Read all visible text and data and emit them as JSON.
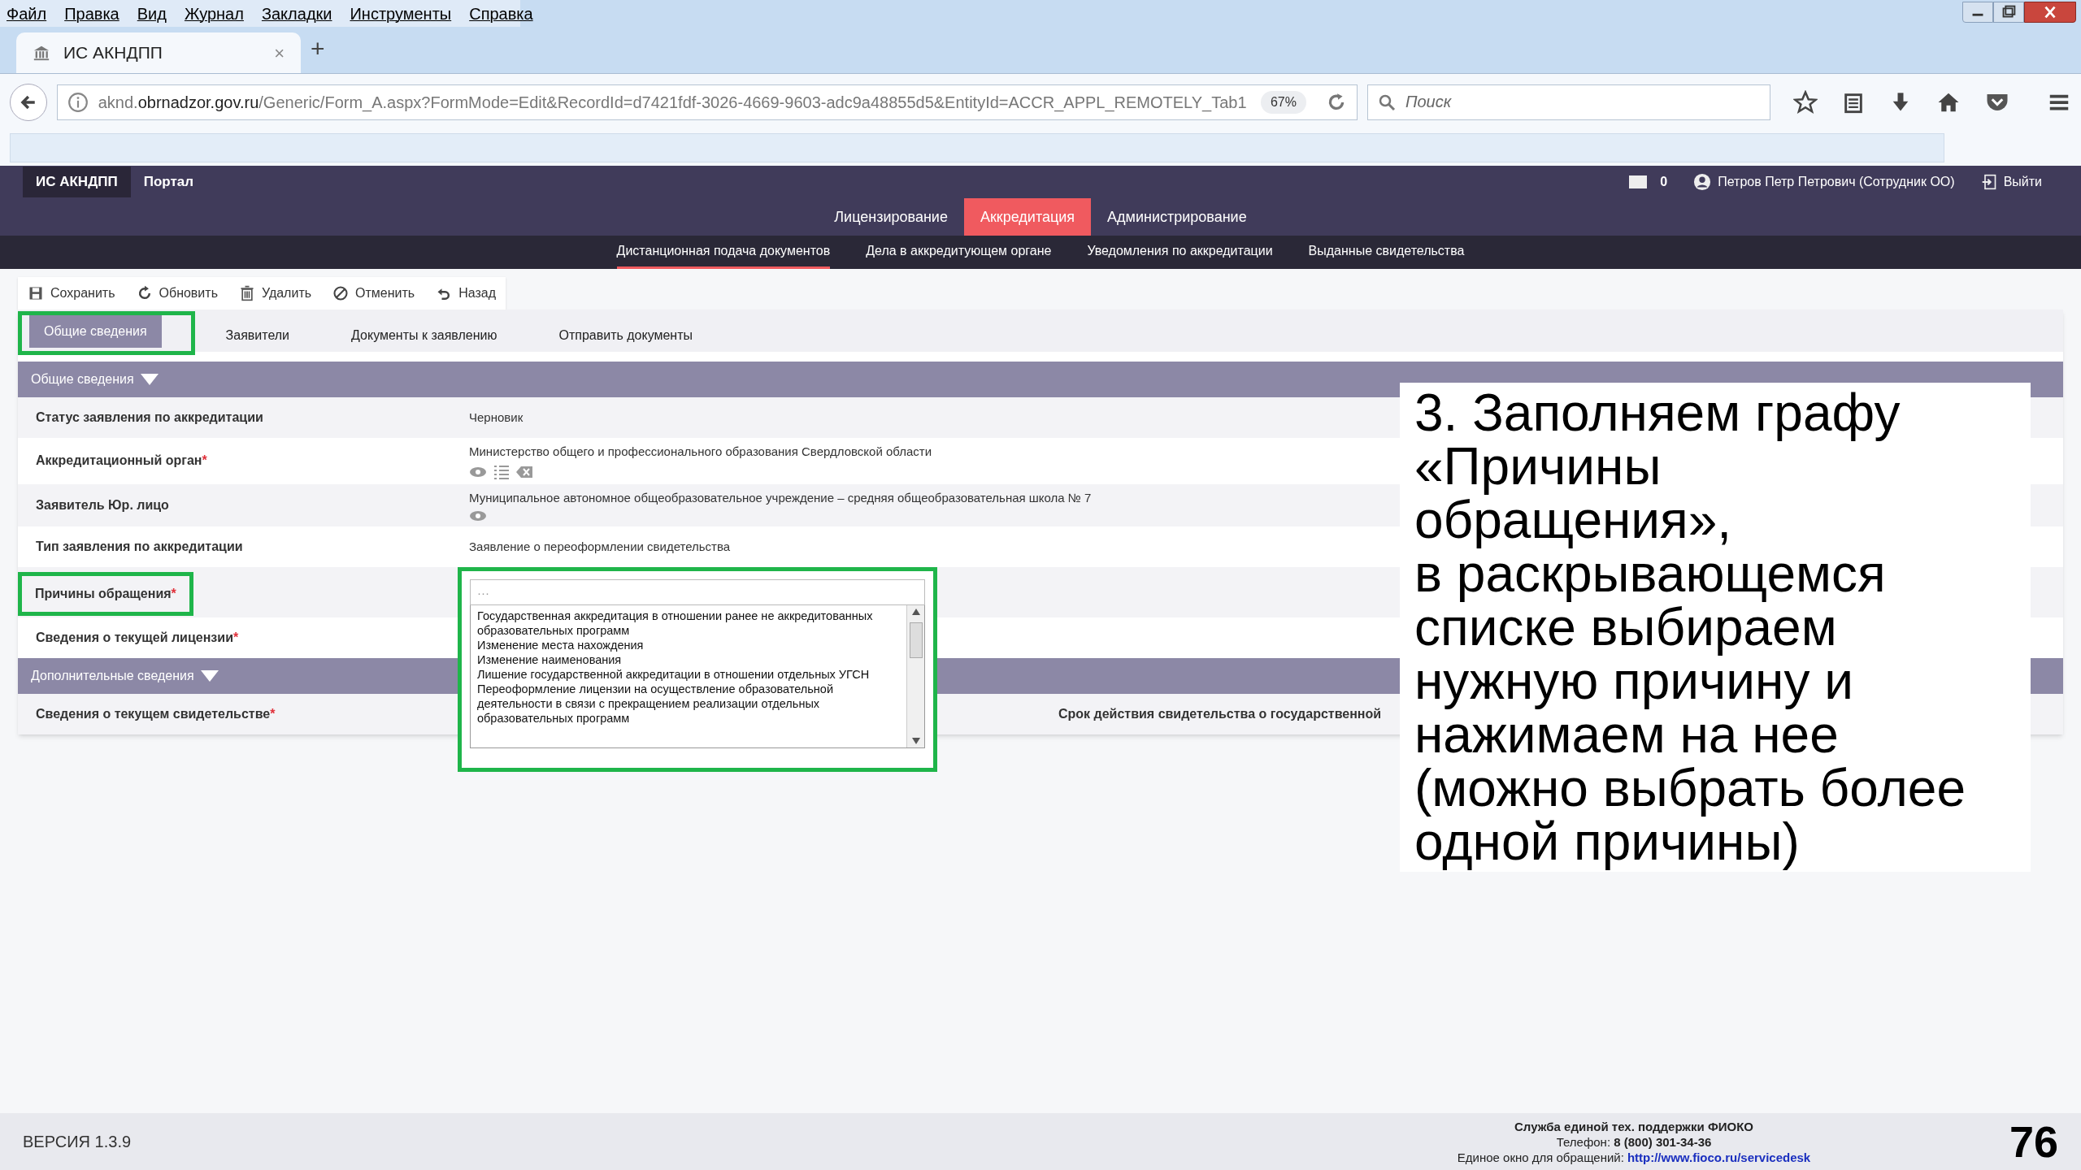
{
  "menu_bar": [
    "Файл",
    "Правка",
    "Вид",
    "Журнал",
    "Закладки",
    "Инструменты",
    "Справка"
  ],
  "browser_tab": {
    "title": "ИС АКНДПП",
    "close": "×"
  },
  "new_tab": "+",
  "address_bar": {
    "prefix": "aknd.",
    "domain": "obrnadzor.gov.ru",
    "path": "/Generic/Form_A.aspx?FormMode=Edit&RecordId=d7421fdf-3026-4669-9603-adc9a48855d5&EntityId=ACCR_APPL_REMOTELY_Tab1",
    "zoom": "67%"
  },
  "search": {
    "placeholder": "Поиск"
  },
  "app": {
    "brand": "ИС АКНДПП",
    "portal": "Портал",
    "messages_count": "0",
    "user": "Петров Петр Петрович (Сотрудник ОО)",
    "logout": "Выйти",
    "nav": [
      {
        "label": "Лицензирование",
        "selected": false
      },
      {
        "label": "Аккредитация",
        "selected": true
      },
      {
        "label": "Администрирование",
        "selected": false
      }
    ],
    "subnav": [
      {
        "label": "Дистанционная подача документов",
        "selected": true
      },
      {
        "label": "Дела в аккредитующем органе",
        "selected": false
      },
      {
        "label": "Уведомления по аккредитации",
        "selected": false
      },
      {
        "label": "Выданные свидетельства",
        "selected": false
      }
    ]
  },
  "toolbar": [
    {
      "kind": "save",
      "label": "Сохранить"
    },
    {
      "kind": "refresh",
      "label": "Обновить"
    },
    {
      "kind": "delete",
      "label": "Удалить"
    },
    {
      "kind": "cancel",
      "label": "Отменить"
    },
    {
      "kind": "back",
      "label": "Назад"
    }
  ],
  "form_tabs": [
    {
      "label": "Общие сведения",
      "selected": true,
      "highlighted": true
    },
    {
      "label": "Заявители",
      "selected": false
    },
    {
      "label": "Документы к заявлению",
      "selected": false
    },
    {
      "label": "Отправить документы",
      "selected": false
    }
  ],
  "sections": [
    {
      "title": "Общие сведения",
      "expanded": true,
      "fields": [
        {
          "kind": "text",
          "label": "Статус заявления по аккредитации",
          "value": "Черновик"
        },
        {
          "kind": "lookup_editable",
          "label": "Аккредитационный орган",
          "required_mark": "*",
          "value": "Министерство общего и профессионального образования Свердловской области"
        },
        {
          "kind": "lookup",
          "label": "Заявитель Юр. лицо",
          "value": "Муниципальное автономное общеобразовательное учреждение – средняя общеобразовательная школа № 7"
        },
        {
          "kind": "text",
          "label": "Тип заявления по аккредитации",
          "value": "Заявление о переоформлении свидетельства"
        },
        {
          "kind": "multiselect",
          "label": "Причины обращения",
          "required_mark": "*",
          "highlighted": true,
          "placeholder": "···",
          "options": [
            "Государственная аккредитация в отношении ранее не аккредитованных образовательных программ",
            "Изменение места нахождения",
            "Изменение наименования",
            "Лишение государственной аккредитации в отношении отдельных УГСН",
            "Переоформление лицензии на осуществление образовательной деятельности в связи с прекращением реализации отдельных образовательных программ"
          ]
        },
        {
          "kind": "text",
          "label": "Сведения о текущей лицензии",
          "required_mark": "*"
        }
      ]
    },
    {
      "title": "Дополнительные сведения",
      "expanded": true,
      "fields": [
        {
          "kind": "text",
          "label": "Сведения о текущем свидетельстве",
          "required_mark": "*",
          "extra_label": "Срок действия свидетельства о государственной"
        }
      ]
    }
  ],
  "annotation": {
    "lines": [
      "3. Заполняем графу",
      "«Причины",
      "обращения»,",
      "в раскрывающемся",
      "списке выбираем",
      "нужную причину и",
      "нажимаем на нее",
      "(можно выбрать более",
      "одной причины)"
    ]
  },
  "footer": {
    "version": "ВЕРСИЯ 1.3.9",
    "support_title": "Служба единой тех. поддержки ФИОКО",
    "phone_label": "Телефон:",
    "phone": "8 (800) 301-34-36",
    "window_label": "Единое окно для обращений:",
    "link": "http://www.fioco.ru/servicedesk"
  },
  "page_number": "76"
}
